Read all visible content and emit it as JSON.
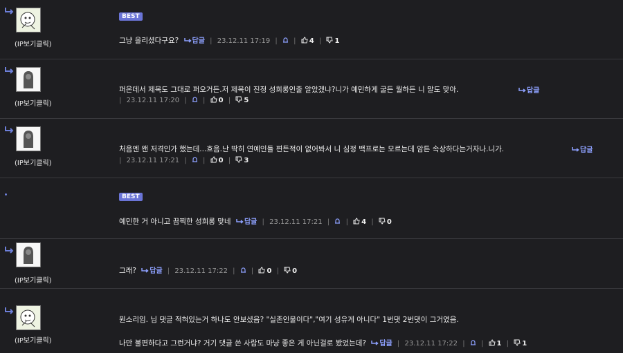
{
  "colors": {
    "background": "#1e1e21",
    "accent": "#6a74d6",
    "link": "#8ea1ff",
    "text": "#ececec",
    "muted": "#9a9a9a"
  },
  "comments": [
    {
      "avatar_icon": "cartoon-face-avatar-icon",
      "ip_label": "(IP보기클릭)",
      "best": true,
      "best_label": "BEST",
      "lines": [
        "그냥 올리셨다구요?"
      ],
      "reply_label": "답글",
      "date": "23.12.11 17:19",
      "likes": "4",
      "dislikes": "1"
    },
    {
      "avatar_icon": "default-silhouette-avatar-icon",
      "ip_label": "(IP보기클릭)",
      "best": false,
      "lines": [
        "퍼온데서 제목도 그대로 퍼오거든.저 제목이 진정 성희롱인줄 알았겠냐?니가 예민하게 굴든 뭘하든 니 말도 맞아."
      ],
      "reply_label": "답글",
      "date": "23.12.11 17:20",
      "likes": "0",
      "dislikes": "5"
    },
    {
      "avatar_icon": "default-silhouette-avatar-icon",
      "ip_label": "(IP보기클릭)",
      "best": false,
      "lines": [
        "처음엔 왠 저격인가 했는데...흐음.난 딱히 연예인들 편든적이 없어봐서 니 심정 백프로는 모르는데 암튼 속상하다는거자나.니가."
      ],
      "reply_label": "답글",
      "date": "23.12.11 17:21",
      "likes": "0",
      "dislikes": "3"
    },
    {
      "avatar_icon": "none",
      "ip_label": "",
      "best": true,
      "best_label": "BEST",
      "lines": [
        "예민한 거 아니고 끔찍한 성희롱 맞네"
      ],
      "reply_label": "답글",
      "date": "23.12.11 17:21",
      "likes": "4",
      "dislikes": "0"
    },
    {
      "avatar_icon": "default-silhouette-avatar-icon",
      "ip_label": "(IP보기클릭)",
      "best": false,
      "lines": [
        "그래?"
      ],
      "reply_label": "답글",
      "date": "23.12.11 17:22",
      "likes": "0",
      "dislikes": "0"
    },
    {
      "avatar_icon": "cartoon-face-avatar-icon",
      "ip_label": "(IP보기클릭)",
      "best": false,
      "lines": [
        "뭔소리임. 님 댓글 적혀있는거 하나도 안보셨음? \"실존인물이다\",\"여기 성유게 아니다\" 1번댓 2번댓이 그거였음.",
        "나만 불편하다고 그런거냐? 거기 댓글 쓴 사람도 마냥 좋은 게 아닌걸로 봤었는데?"
      ],
      "reply_label": "답글",
      "date": "23.12.11 17:22",
      "likes": "1",
      "dislikes": "1"
    }
  ]
}
